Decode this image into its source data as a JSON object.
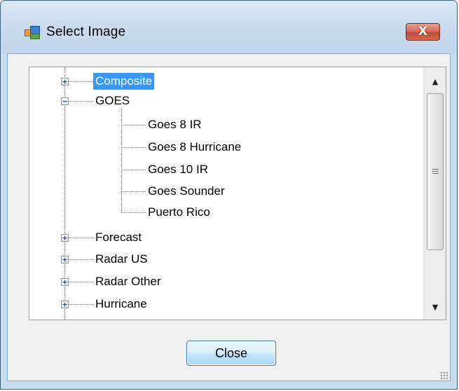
{
  "window": {
    "title": "Select Image",
    "close_glyph": "X"
  },
  "tree": {
    "nodes": [
      {
        "label": "Composite",
        "expander": "+",
        "selected": true
      },
      {
        "label": "GOES",
        "expander": "−",
        "selected": false,
        "children": [
          {
            "label": "Goes 8 IR"
          },
          {
            "label": "Goes 8 Hurricane"
          },
          {
            "label": "Goes 10 IR"
          },
          {
            "label": "Goes Sounder"
          },
          {
            "label": "Puerto Rico"
          }
        ]
      },
      {
        "label": "Forecast",
        "expander": "+",
        "selected": false
      },
      {
        "label": "Radar US",
        "expander": "+",
        "selected": false
      },
      {
        "label": "Radar Other",
        "expander": "+",
        "selected": false
      },
      {
        "label": "Hurricane",
        "expander": "+",
        "selected": false
      }
    ]
  },
  "scrollbar": {
    "up_icon": "up-arrow-icon",
    "down_icon": "down-arrow-icon"
  },
  "buttons": {
    "close_label": "Close"
  },
  "colors": {
    "selection": "#3399ff",
    "window_frame": "#c7dcee",
    "close_button_red": "#c14a36"
  }
}
